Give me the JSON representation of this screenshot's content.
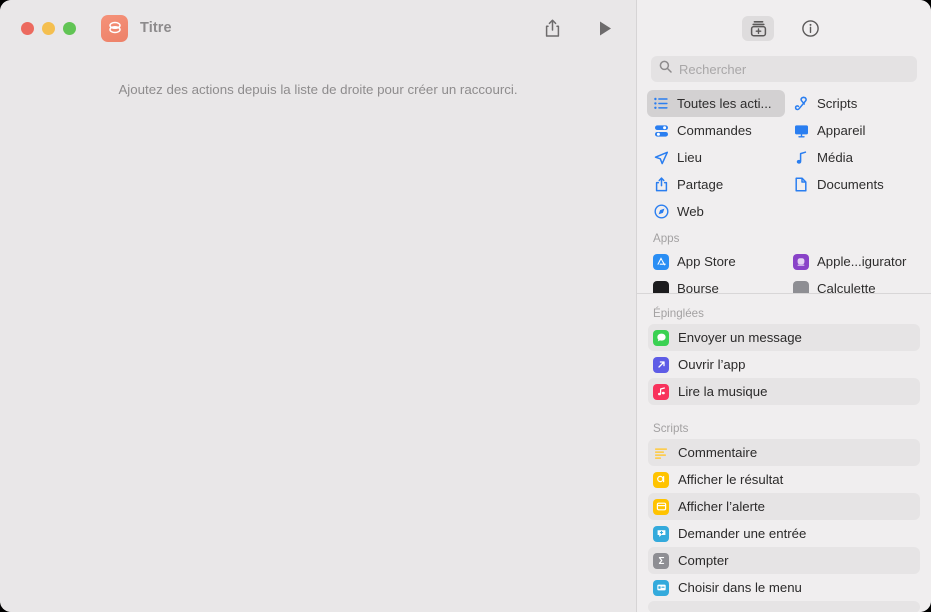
{
  "window": {
    "title": "Titre",
    "app_icon": "shortcuts-icon",
    "canvas_hint": "Ajoutez des actions depuis la liste de droite pour créer un raccourci.",
    "traffic_lights": [
      "close",
      "minimize",
      "zoom"
    ],
    "toolbar": {
      "share_label": "share-icon",
      "run_label": "play-icon"
    }
  },
  "panel": {
    "toolbar": {
      "library_label": "action-library-icon",
      "info_label": "info-icon"
    },
    "search": {
      "placeholder": "Rechercher",
      "value": "",
      "icon": "search-icon"
    },
    "categories": [
      {
        "label": "Toutes les acti...",
        "icon": "list-icon",
        "selected": true
      },
      {
        "label": "Scripts",
        "icon": "script-icon",
        "selected": false
      },
      {
        "label": "Commandes",
        "icon": "controls-icon",
        "selected": false
      },
      {
        "label": "Appareil",
        "icon": "display-icon",
        "selected": false
      },
      {
        "label": "Lieu",
        "icon": "location-icon",
        "selected": false
      },
      {
        "label": "Média",
        "icon": "music-note-icon",
        "selected": false
      },
      {
        "label": "Partage",
        "icon": "share-icon",
        "selected": false
      },
      {
        "label": "Documents",
        "icon": "document-icon",
        "selected": false
      },
      {
        "label": "Web",
        "icon": "compass-icon",
        "selected": false
      }
    ],
    "apps_section": {
      "title": "Apps",
      "items": [
        {
          "label": "App Store",
          "icon": "app-store-icon",
          "color": "#2a8ef4"
        },
        {
          "label": "Apple...igurator",
          "icon": "apple-configurator-icon",
          "color": "#8942c8"
        },
        {
          "label": "Bourse",
          "icon": "stocks-icon",
          "color": "#1c1c1e"
        },
        {
          "label": "Calculette",
          "icon": "calculator-icon",
          "color": "#8e8e93"
        }
      ]
    },
    "pinned_section": {
      "title": "Épinglées",
      "items": [
        {
          "label": "Envoyer un message",
          "icon": "messages-icon",
          "color": "#3ad152"
        },
        {
          "label": "Ouvrir l’app",
          "icon": "open-app-icon",
          "color": "#5e5ce6"
        },
        {
          "label": "Lire la musique",
          "icon": "music-icon",
          "color": "#f8325c"
        }
      ]
    },
    "scripts_section": {
      "title": "Scripts",
      "items": [
        {
          "label": "Commentaire",
          "icon": "comment-icon",
          "color": "#ffffff"
        },
        {
          "label": "Afficher le résultat",
          "icon": "show-result-icon",
          "color": "#ffc300"
        },
        {
          "label": "Afficher l’alerte",
          "icon": "show-alert-icon",
          "color": "#ffc300"
        },
        {
          "label": "Demander une entrée",
          "icon": "ask-input-icon",
          "color": "#34aadc"
        },
        {
          "label": "Compter",
          "icon": "count-icon",
          "color": "#8e8e93"
        },
        {
          "label": "Choisir dans le menu",
          "icon": "choose-menu-icon",
          "color": "#34aadc"
        }
      ]
    }
  },
  "colors": {
    "accent_blue": "#2a7ef0",
    "window_bg": "#e9e7e8",
    "panel_bg": "#f0eeef",
    "selection": "#d3d1d2"
  }
}
